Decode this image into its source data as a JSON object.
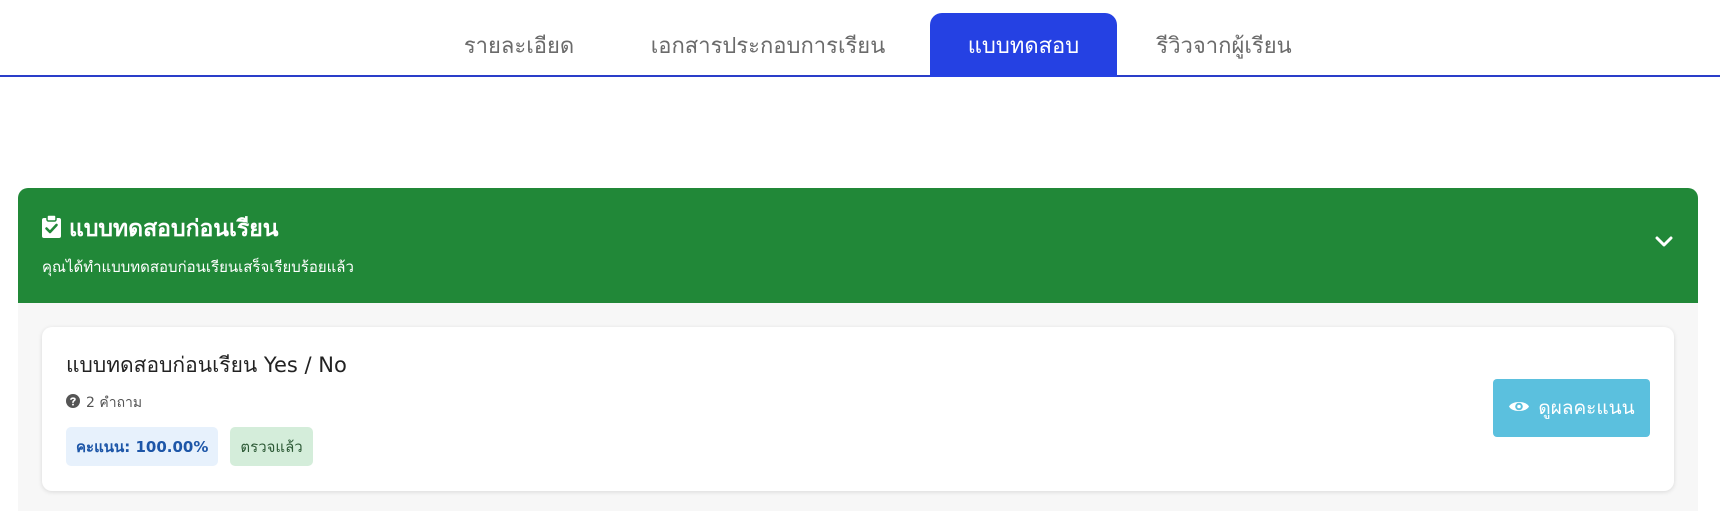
{
  "tabs": [
    {
      "label": "รายละเอียด"
    },
    {
      "label": "เอกสารประกอบการเรียน"
    },
    {
      "label": "แบบทดสอบ"
    },
    {
      "label": "รีวิวจากผู้เรียน"
    }
  ],
  "accordion": {
    "title": "แบบทดสอบก่อนเรียน",
    "subtitle": "คุณได้ทำแบบทดสอบก่อนเรียนเสร็จเรียบร้อยแล้ว",
    "icon": "clipboard-check-icon",
    "toggle_icon": "chevron-down-icon"
  },
  "quiz": {
    "title": "แบบทดสอบก่อนเรียน Yes / No",
    "question_count": "2 คำถาม",
    "score_badge": "คะแนน: 100.00%",
    "status_badge": "ตรวจแล้ว",
    "view_button": "ดูผลคะแนน",
    "view_icon": "eye-icon",
    "meta_icon": "question-circle-icon"
  },
  "colors": {
    "accent": "#2541e3",
    "header_green": "#218838",
    "button_info": "#5bc0de",
    "score_badge_bg": "#e7f1fc",
    "status_badge_bg": "#d4edda"
  }
}
